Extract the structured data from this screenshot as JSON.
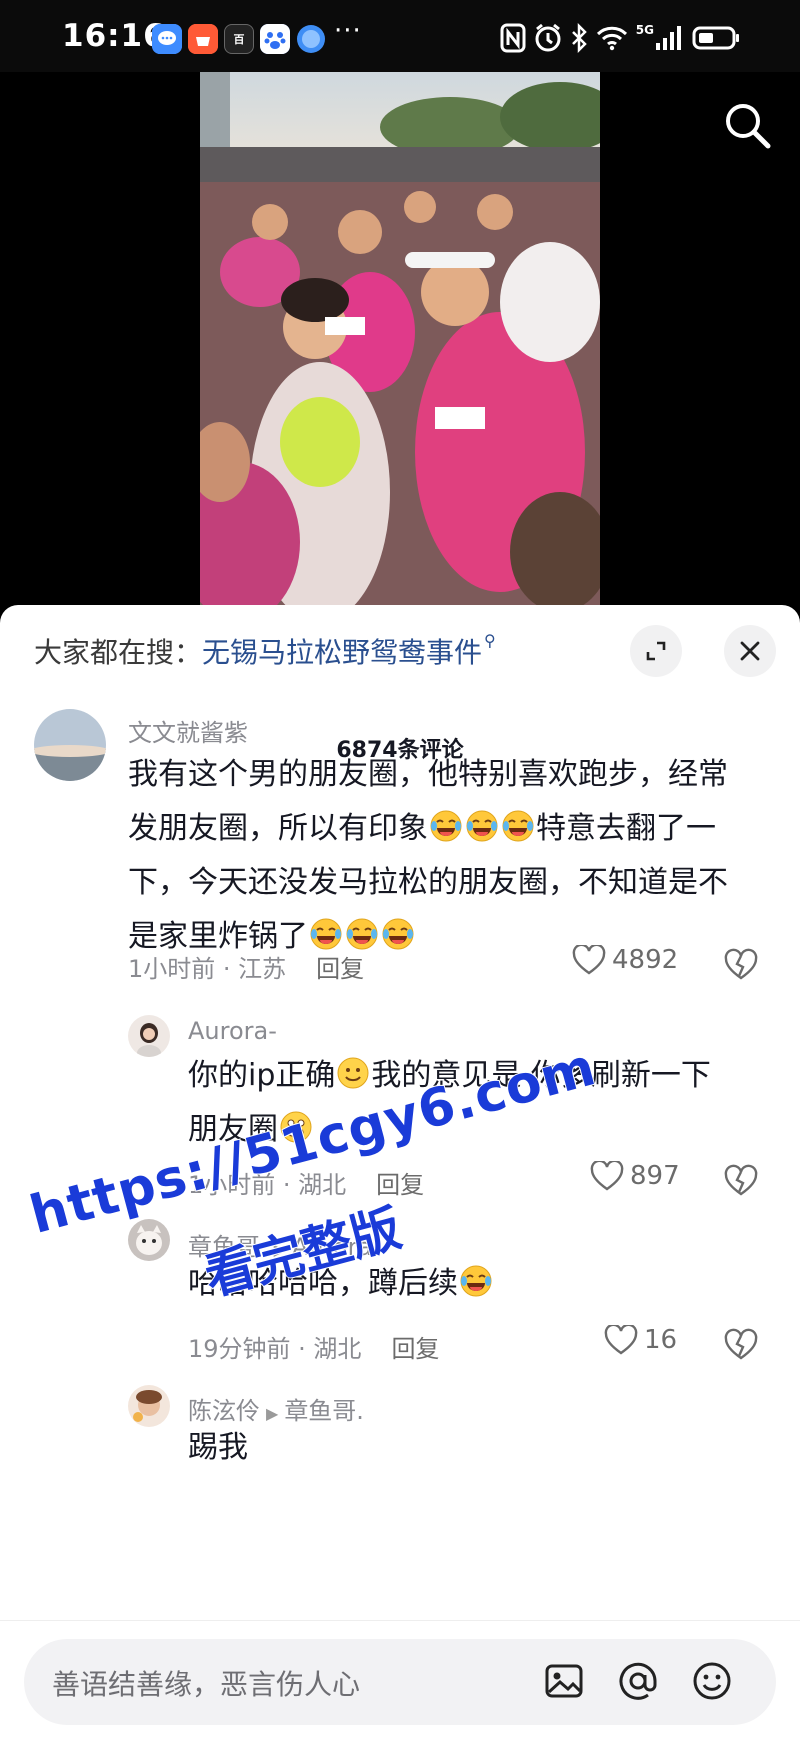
{
  "status_bar": {
    "time": "16:16",
    "app_icons": [
      "message-icon",
      "shop-icon",
      "news-icon",
      "baidu-icon",
      "browser-icon"
    ],
    "news_icon_text": "百",
    "more": "···",
    "indicators": [
      "nfc-icon",
      "alarm-icon",
      "bluetooth-icon",
      "wifi-icon",
      "5g-signal-icon",
      "battery-icon"
    ],
    "network": "5G"
  },
  "video": {
    "description_icon": "search-icon"
  },
  "sheet": {
    "hot_search_prefix": "大家都在搜：",
    "hot_search_term": "无锡马拉松野鸳鸯事件",
    "comment_count": "6874条评论"
  },
  "comments": [
    {
      "author": "文文就酱紫",
      "lines": [
        "我有这个男的朋友圈，他特别喜欢跑步，经常",
        "发朋友圈，所以有印象",
        "特意去翻了一",
        "下，今天还没发马拉松的朋友圈，不知道是不",
        "是家里炸锅了"
      ],
      "time": "1小时前 · 江苏",
      "reply": "回复",
      "likes": "4892"
    },
    {
      "author": "Aurora-",
      "line1a": "你的ip正确",
      "line1b": "我的意见是 你多刷新一下",
      "line2": "朋友圈",
      "time": "1小时前 · 湖北",
      "reply": "回复",
      "likes": "897"
    },
    {
      "author": "章鱼哥.",
      "reply_to": "Aurora-",
      "text": "哈哈哈哈哈，蹲后续",
      "time": "19分钟前 · 湖北",
      "reply": "回复",
      "likes": "16"
    },
    {
      "author": "陈泫伶",
      "reply_to": "章鱼哥.",
      "text": "踢我"
    }
  ],
  "watermark": {
    "url": "https://51cgy6.com",
    "text": "看完整版"
  },
  "input": {
    "placeholder": "善语结善缘，恶言伤人心"
  },
  "colors": {
    "link": "#2a4f8f",
    "watermark": "#1a3bd8",
    "muted": "#8a8b91"
  }
}
